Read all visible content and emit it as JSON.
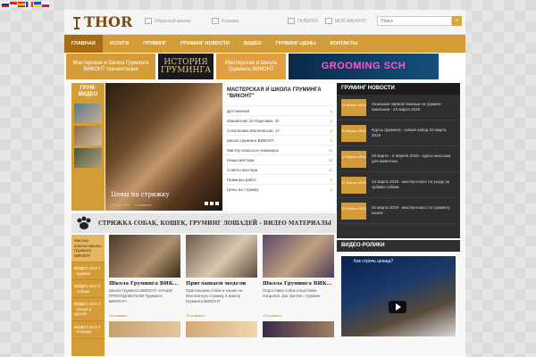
{
  "header": {
    "logo_text": "THOR",
    "feedback": "Обратный звонок",
    "cart": "Корзина",
    "gallery": "ГАЛЕРЕЯ",
    "account": "МОЙ АККАУНТ",
    "search_placeholder": "Поиск",
    "search_button": "»"
  },
  "nav": {
    "items": [
      "ГЛАВНАЯ",
      "УСЛУГИ",
      "ГРУМИНГ",
      "ГРУМИНГ НОВОСТИ",
      "ВИДЕО",
      "ГРУМИНГ-ЦЕНЫ",
      "КОНТАКТЫ"
    ],
    "active_index": 0
  },
  "banners": {
    "b1": "Мастерская и Школа Груминга ВИКОНТ презентация",
    "b2": "ИСТОРИЯ ГРУМИНГА",
    "b3": "Мастерская и Школа Груминга ВИКОНТ",
    "b4": "GROOMING SCH"
  },
  "video_tab": {
    "title": "ГРУМ-ВИДЕО"
  },
  "hero": {
    "title": "Цены на стрижку",
    "date": "16 Дек 2016",
    "comments": "0 коммент."
  },
  "school": {
    "title": "МАСТЕРСКАЯ И ШКОЛА ГРУМИНГА \"ВИКОНТ\"",
    "rows": [
      {
        "label": "Достижения",
        "count": "0"
      },
      {
        "label": "Измайлово 16 Парковая, 20",
        "count": "0"
      },
      {
        "label": "Сокольники,Малеевская, 17",
        "count": "0"
      },
      {
        "label": "Школа груминга ВИКОНТ",
        "count": "0"
      },
      {
        "label": "Мастер классы и семинары",
        "count": "15"
      },
      {
        "label": "Наши мастера",
        "count": "15"
      },
      {
        "label": "Советы мастера",
        "count": "11"
      },
      {
        "label": "Примеры работ",
        "count": "0"
      },
      {
        "label": "Цены на стрижку",
        "count": "0"
      }
    ]
  },
  "news": {
    "title": "ГРУМИНГ НОВОСТИ",
    "items": [
      {
        "date": "24 Марта 2019",
        "text": "Оказание первой помощи на груминг-кампании - 24 марта 2019"
      },
      {
        "date": "20 Марта 2019",
        "text": "Курсы груминга - новый набор 23 марта 2019"
      },
      {
        "date": "12 Марта 2019",
        "text": "28 марта - 2 апреля 2019 - курсы массажа для животных"
      },
      {
        "date": "11 Марта 2019",
        "text": "13 марта 2019 - мастер-класс по уходу за зубами собаки"
      },
      {
        "date": "02 Марта 2019",
        "text": "04 марта 2019 - мастер-класс по грумингу кошек"
      }
    ]
  },
  "shear_bar": {
    "text": "СТРИЖКА СОБАК, КОШЕК, ГРУМИНГ ЛОШАДЕЙ - ВИДЕО МАТЕРИАЛЫ"
  },
  "side_list": {
    "items": [
      "Мастер-классы Школы Груминга ВИКОНТ",
      "ВИДЕО ЗАЛ 1 - груминг",
      "ВИДЕО ЗАЛ 2 - собаки",
      "ВИДЕО ЗАЛ 3 - кошки и другие",
      "ВИДЕО ЗАЛ 4 - лошади"
    ],
    "active_index": 0
  },
  "cards": [
    {
      "title": "Школа Груминга ВИК...",
      "desc": "Школа Груминга ВИКОНТ «НАШИ ПРЕПОДАВАТЕЛИ Груминга ВИКОНТ»",
      "comments": "10 коммент."
    },
    {
      "title": "Приглашаем модели",
      "desc": "Приглашаем собак и кошек на бесплатную стрижку в Школу Груминга ВИКОНТ",
      "comments": "10 коммент."
    },
    {
      "title": "Школа Груминга ВИК...",
      "desc": "Подготовка собак к выставке. Хэндлинг. Дог фитнес. Груминг",
      "comments": "10 коммент."
    }
  ],
  "video_section": {
    "title": "ВИДЕО-РОЛИКИ",
    "video_title": "Как стричь шпица?"
  },
  "colors": {
    "accent": "#d49c36",
    "nav_active": "#a86d12",
    "news_bg": "#2f2f2f"
  }
}
